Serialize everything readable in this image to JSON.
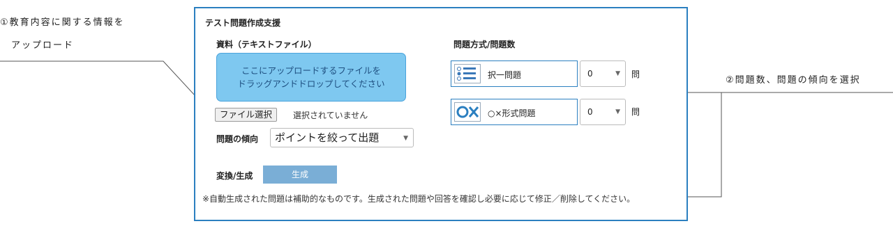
{
  "callouts": {
    "left_line1": "①教育内容に関する情報を",
    "left_line2": "アップロード",
    "right": "②問題数、問題の傾向を選択"
  },
  "panel": {
    "title": "テスト問題作成支援",
    "material_label": "資料（テキストファイル）",
    "dropzone_line1": "ここにアップロードするファイルを",
    "dropzone_line2": "ドラッグアンドドロップしてください",
    "file_button": "ファイル選択",
    "file_status": "選択されていません",
    "tendency_label": "問題の傾向",
    "tendency_value": "ポイントを絞って出題",
    "convert_label": "変換/生成",
    "generate_button": "生成",
    "note": "※自動生成された問題は補助的なものです。生成された問題や回答を確認し必要に応じて修正／削除してください。",
    "format_label": "問題方式/問題数",
    "formats": [
      {
        "label": "択一問題",
        "count": "0",
        "unit": "問",
        "icon": "multiple-choice-icon"
      },
      {
        "label": "○×形式問題",
        "count": "0",
        "unit": "問",
        "icon": "ox-icon"
      }
    ]
  },
  "colors": {
    "accent": "#2b7fc0",
    "dropzone": "#7ec8f0",
    "button": "#7aaed6"
  }
}
